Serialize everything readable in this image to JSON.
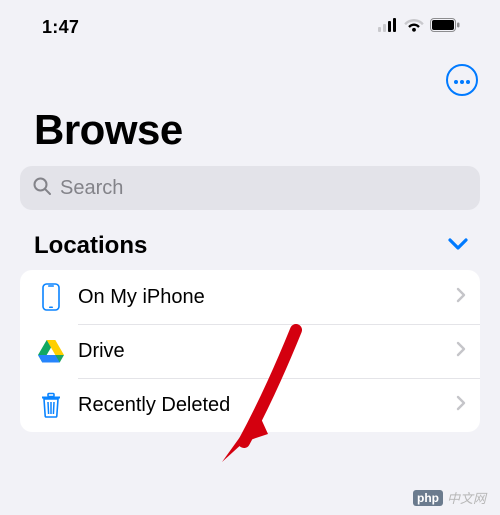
{
  "status": {
    "time": "1:47"
  },
  "accent": "#007aff",
  "page_title": "Browse",
  "search": {
    "placeholder": "Search"
  },
  "section": {
    "title": "Locations"
  },
  "items": [
    {
      "label": "On My iPhone"
    },
    {
      "label": "Drive"
    },
    {
      "label": "Recently Deleted"
    }
  ],
  "watermark": {
    "badge": "php",
    "text": "中文网"
  }
}
